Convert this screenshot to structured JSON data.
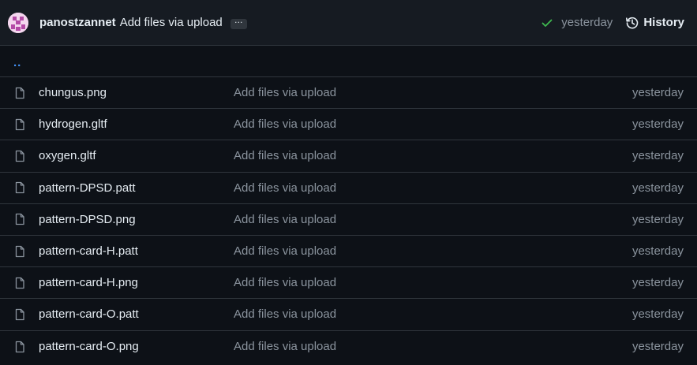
{
  "commit": {
    "author": "panostzannet",
    "message": "Add files via upload",
    "more_label": "…",
    "time": "yesterday",
    "history_label": "History"
  },
  "parent": {
    "label": ".."
  },
  "files": [
    {
      "name": "chungus.png",
      "message": "Add files via upload",
      "date": "yesterday"
    },
    {
      "name": "hydrogen.gltf",
      "message": "Add files via upload",
      "date": "yesterday"
    },
    {
      "name": "oxygen.gltf",
      "message": "Add files via upload",
      "date": "yesterday"
    },
    {
      "name": "pattern-DPSD.patt",
      "message": "Add files via upload",
      "date": "yesterday"
    },
    {
      "name": "pattern-DPSD.png",
      "message": "Add files via upload",
      "date": "yesterday"
    },
    {
      "name": "pattern-card-H.patt",
      "message": "Add files via upload",
      "date": "yesterday"
    },
    {
      "name": "pattern-card-H.png",
      "message": "Add files via upload",
      "date": "yesterday"
    },
    {
      "name": "pattern-card-O.patt",
      "message": "Add files via upload",
      "date": "yesterday"
    },
    {
      "name": "pattern-card-O.png",
      "message": "Add files via upload",
      "date": "yesterday"
    }
  ],
  "icons": {
    "avatar": "identicon-avatar",
    "status": "check-icon",
    "history": "history-icon",
    "file": "file-icon"
  },
  "colors": {
    "background": "#0d1117",
    "header_background": "#161b22",
    "border": "#30363d",
    "link": "#4493f8",
    "success": "#3fb950",
    "muted_text": "#8b949e",
    "text": "#e6edf3"
  }
}
